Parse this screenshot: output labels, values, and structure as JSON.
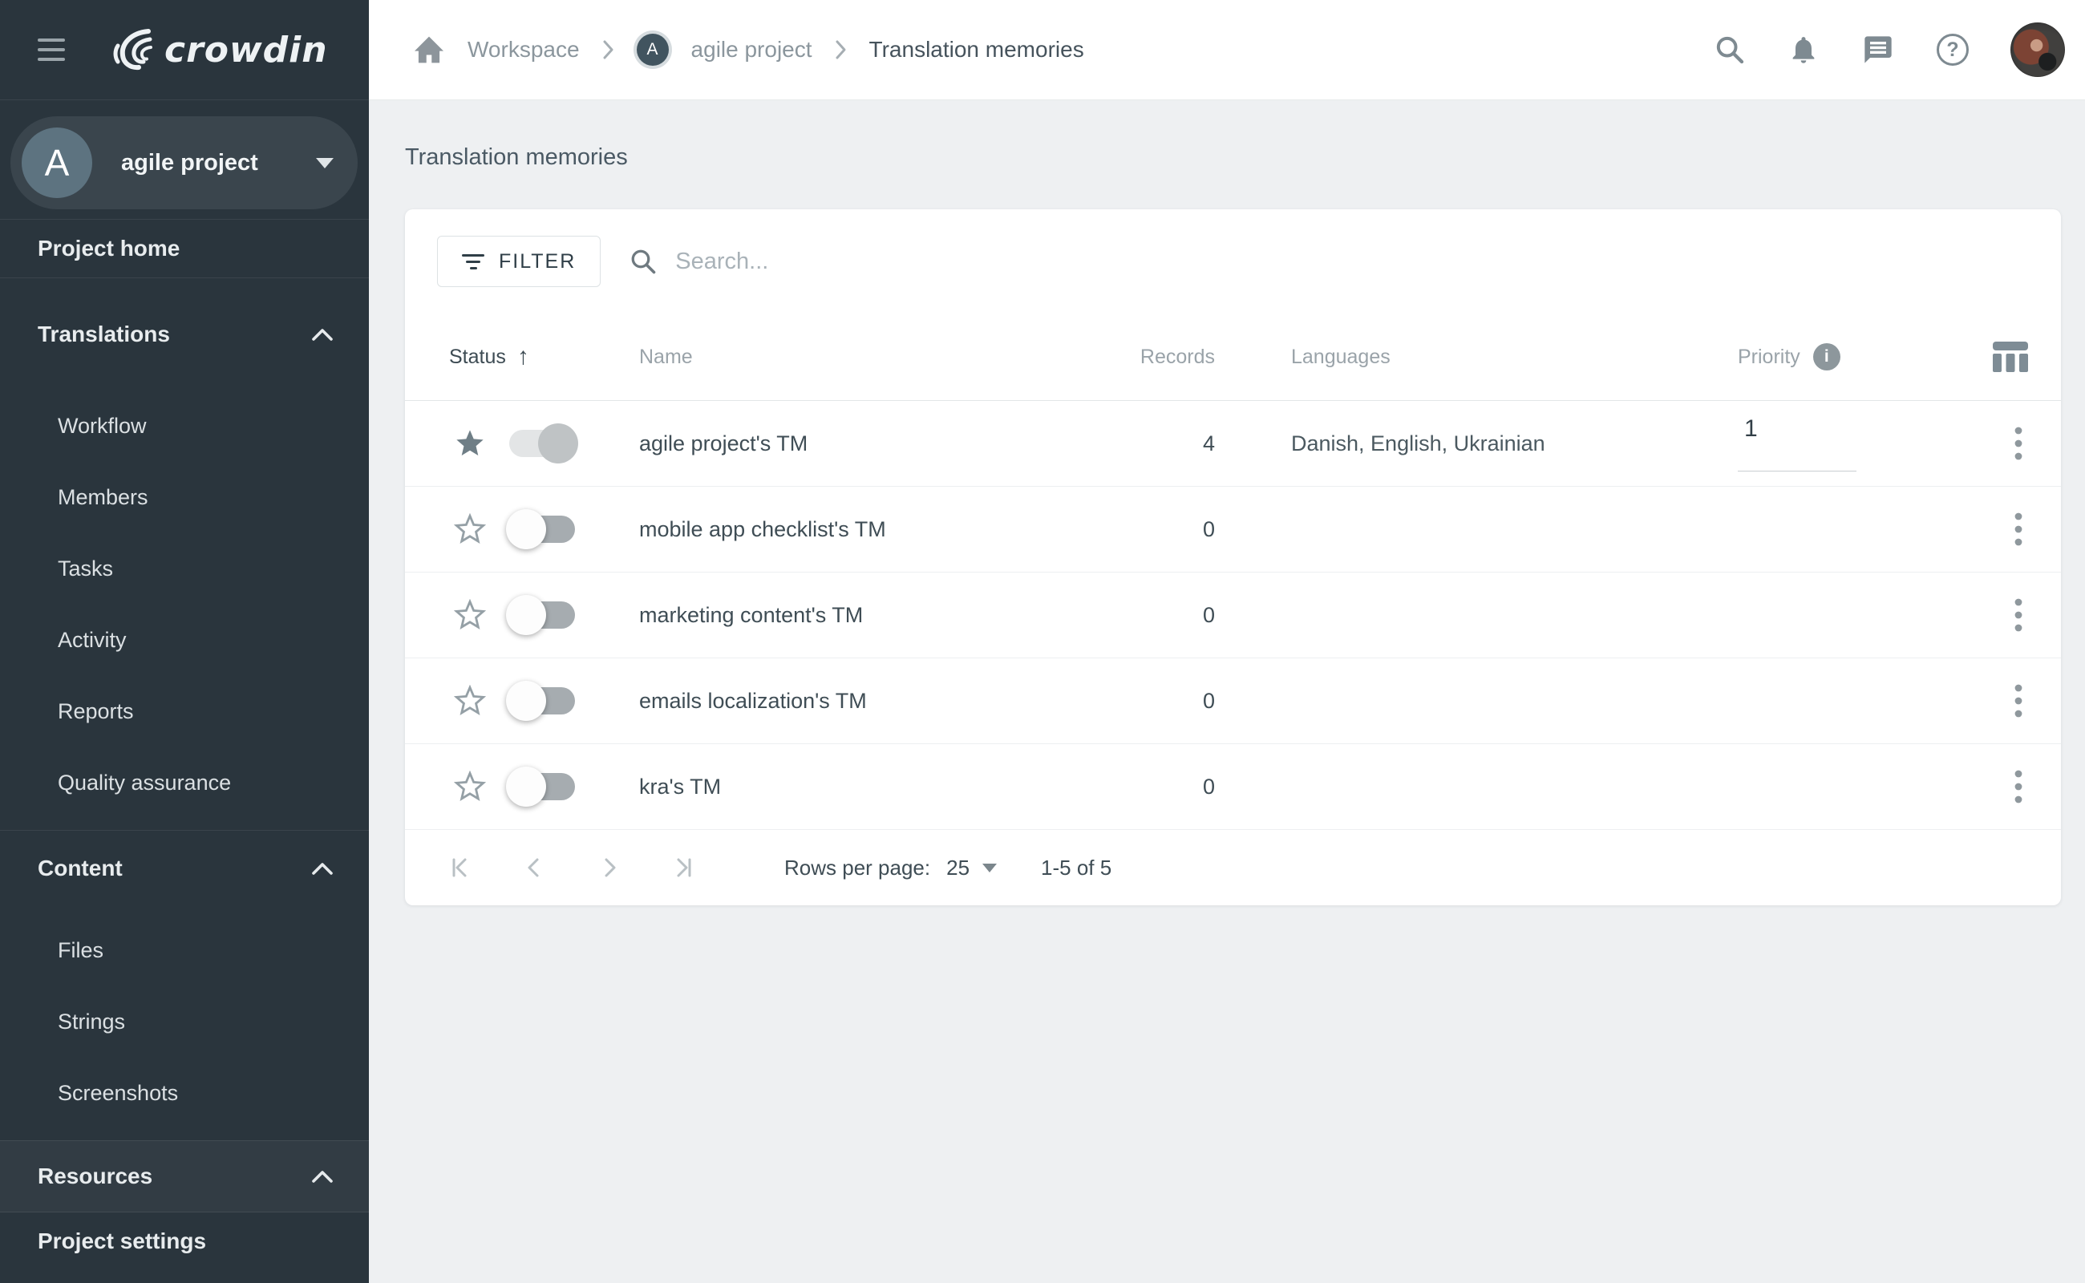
{
  "brand": {
    "wordmark": "crowdin"
  },
  "colors": {
    "sidebar_bg": "#2a353d",
    "sidebar_pill_bg": "#3a454d",
    "avatar_slate": "#5d7380",
    "topbar_bg": "#ffffff",
    "content_bg": "#eef0f2",
    "text_dark": "#3f4d55",
    "text_muted": "#9aa3a9"
  },
  "icons": {
    "hamburger": "menu-bars",
    "search": "magnifier",
    "notifications": "bell",
    "messages": "chat-bubble",
    "help": "question-circle",
    "home": "house",
    "filter": "filter-list",
    "sort": "arrow-up",
    "info": "info-circle",
    "columns": "table-columns",
    "favorite": "star",
    "more": "kebab-vertical",
    "pager": [
      "first-page",
      "prev-page",
      "next-page",
      "last-page"
    ]
  },
  "sidebar": {
    "project": {
      "initial": "A",
      "name": "agile project"
    },
    "sections": [
      {
        "label": "Project home"
      },
      {
        "label": "Translations",
        "items": [
          "Workflow",
          "Members",
          "Tasks",
          "Activity",
          "Reports",
          "Quality assurance"
        ]
      },
      {
        "label": "Content",
        "items": [
          "Files",
          "Strings",
          "Screenshots"
        ]
      },
      {
        "label": "Resources",
        "items": []
      },
      {
        "label": "Project settings"
      }
    ]
  },
  "topbar": {
    "breadcrumb": {
      "workspace": "Workspace",
      "project_initial": "A",
      "project": "agile project",
      "current": "Translation memories"
    }
  },
  "main": {
    "title": "Translation memories",
    "toolbar": {
      "filter_label": "FILTER",
      "search_placeholder": "Search..."
    },
    "table": {
      "columns": {
        "status": "Status",
        "name": "Name",
        "records": "Records",
        "languages": "Languages",
        "priority": "Priority"
      },
      "rows": [
        {
          "starred": true,
          "enabled": true,
          "name": "agile project's TM",
          "records": "4",
          "languages": "Danish, English, Ukrainian",
          "priority": "1"
        },
        {
          "starred": false,
          "enabled": false,
          "name": "mobile app checklist's TM",
          "records": "0",
          "languages": "",
          "priority": ""
        },
        {
          "starred": false,
          "enabled": false,
          "name": "marketing content's TM",
          "records": "0",
          "languages": "",
          "priority": ""
        },
        {
          "starred": false,
          "enabled": false,
          "name": "emails localization's TM",
          "records": "0",
          "languages": "",
          "priority": ""
        },
        {
          "starred": false,
          "enabled": false,
          "name": "kra's TM",
          "records": "0",
          "languages": "",
          "priority": ""
        }
      ]
    },
    "pagination": {
      "rows_per_page_label": "Rows per page:",
      "rows_per_page_value": "25",
      "range_label": "1-5 of 5"
    }
  }
}
